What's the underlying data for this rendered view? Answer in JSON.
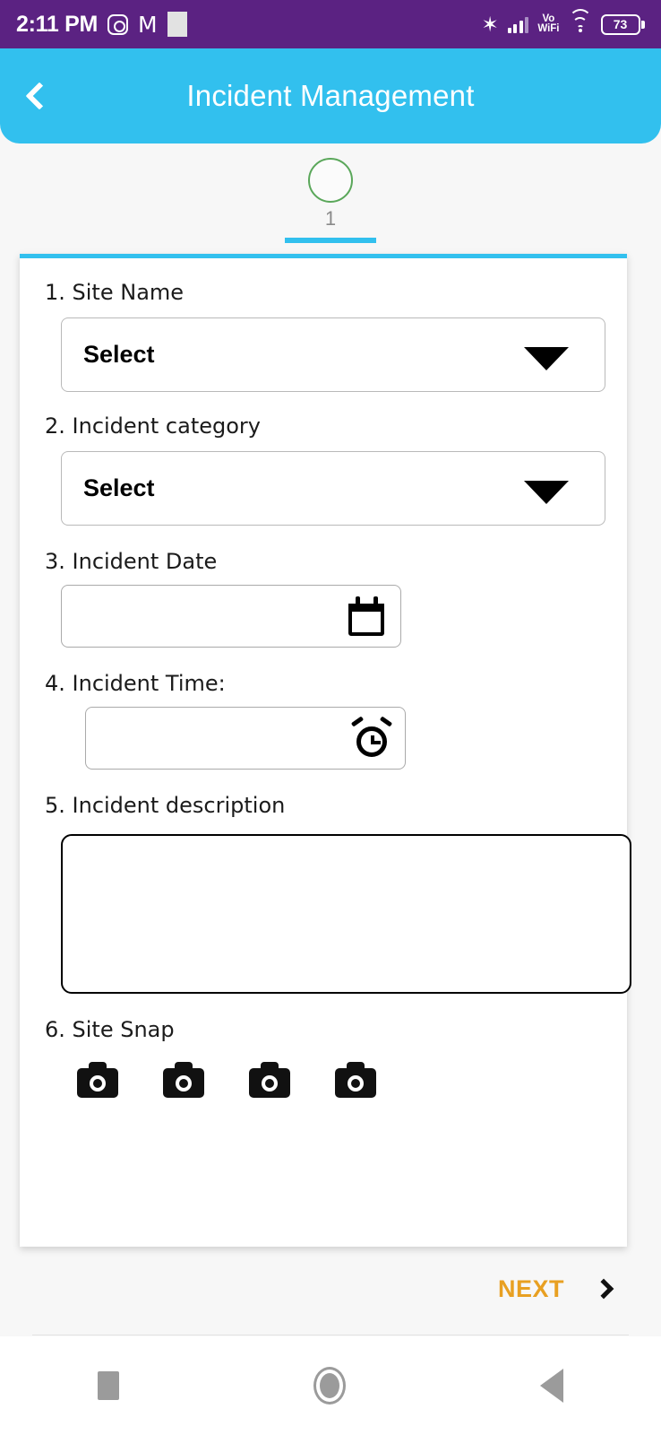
{
  "status_bar": {
    "time": "2:11 PM",
    "icons": [
      "instagram-icon",
      "gmail-icon",
      "app-placeholder-icon",
      "bluetooth-icon",
      "signal-bars-icon",
      "wifi-icon"
    ],
    "network_label": "Vo",
    "network_label2": "WiFi",
    "battery_level": "73",
    "background_color": "#5b2282"
  },
  "app_bar": {
    "title": "Incident Management",
    "back_icon": "chevron-left-icon",
    "background_color": "#32c0ee"
  },
  "stepper": {
    "current_step_label": "1",
    "circle_color": "#5aa75a",
    "indicator_color": "#32c0ee"
  },
  "form": {
    "fields": [
      {
        "label": "1. Site Name",
        "type": "select",
        "value": "Select",
        "placeholder": "Select"
      },
      {
        "label": "2. Incident category",
        "type": "select",
        "value": "Select",
        "placeholder": "Select"
      },
      {
        "label": "3. Incident  Date",
        "type": "date",
        "value": "",
        "icon": "calendar-icon"
      },
      {
        "label": "4. Incident Time:",
        "type": "time",
        "value": "",
        "icon": "alarm-clock-icon"
      },
      {
        "label": "5. Incident description",
        "type": "textarea",
        "value": ""
      },
      {
        "label": "6. Site Snap",
        "type": "photos",
        "count": 4,
        "icon": "camera-icon"
      }
    ]
  },
  "footer": {
    "next_label": "NEXT",
    "next_icon": "chevron-right-icon",
    "next_color": "#e8a022"
  },
  "nav_bar": {
    "recents": "recents-square-icon",
    "home": "home-circle-icon",
    "back": "back-triangle-icon"
  }
}
